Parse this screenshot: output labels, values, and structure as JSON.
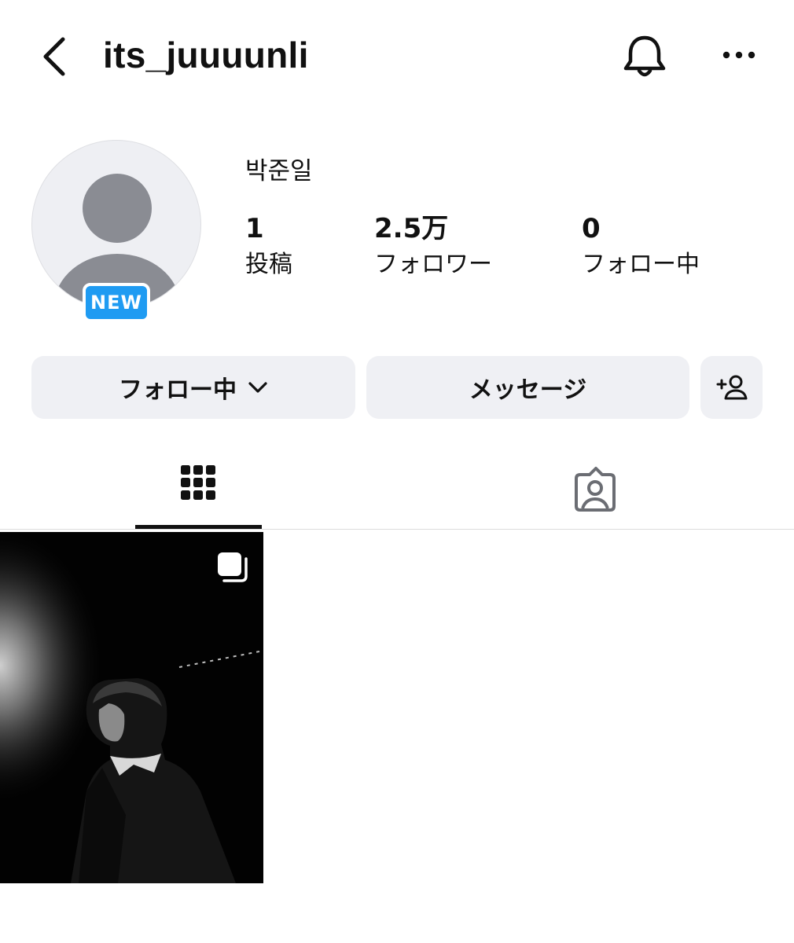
{
  "header": {
    "username": "its_juuuunli",
    "back_icon": "chevron-left-icon",
    "bell_icon": "bell-icon",
    "more_icon": "more-horizontal-icon"
  },
  "profile": {
    "display_name": "박준일",
    "new_badge": "NEW",
    "stats": {
      "posts": {
        "value": "1",
        "label": "投稿"
      },
      "followers": {
        "value": "2.5万",
        "label": "フォロワー"
      },
      "following": {
        "value": "0",
        "label": "フォロー中"
      }
    }
  },
  "actions": {
    "following_label": "フォロー中",
    "message_label": "メッセージ",
    "add_user_icon": "add-user-icon"
  },
  "tabs": [
    {
      "name": "posts",
      "icon": "grid-icon",
      "active": true
    },
    {
      "name": "tagged",
      "icon": "tagged-person-icon",
      "active": false
    }
  ],
  "posts": [
    {
      "type": "carousel",
      "icon": "multiple-photos-icon",
      "description_visible": false
    }
  ],
  "colors": {
    "badge_blue": "#1f9bf2",
    "button_bg": "#eff0f4",
    "text": "#111111",
    "avatar_placeholder": "#8a8c93"
  }
}
